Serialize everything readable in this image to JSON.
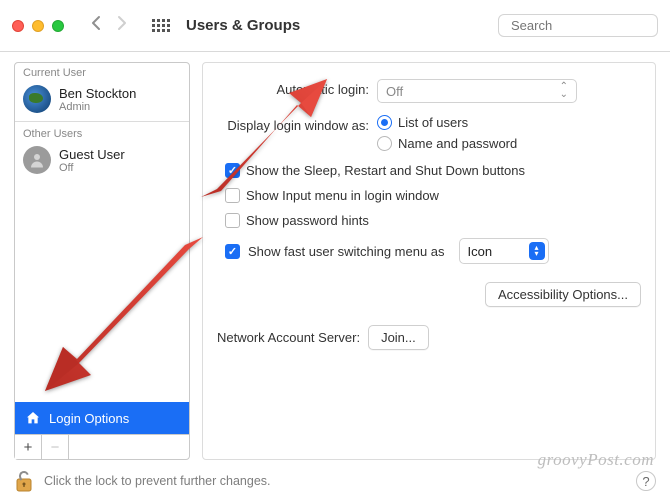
{
  "header": {
    "title": "Users & Groups",
    "search_placeholder": "Search"
  },
  "sidebar": {
    "section_current": "Current User",
    "section_other": "Other Users",
    "current": {
      "name": "Ben Stockton",
      "role": "Admin"
    },
    "other": {
      "name": "Guest User",
      "role": "Off"
    },
    "login_options": "Login Options",
    "add": "+",
    "remove": "−"
  },
  "settings": {
    "auto_login_label": "Automatic login:",
    "auto_login_value": "Off",
    "display_label": "Display login window as:",
    "radio_list": "List of users",
    "radio_namepw": "Name and password",
    "cb_sleep": "Show the Sleep, Restart and Shut Down buttons",
    "cb_input": "Show Input menu in login window",
    "cb_hints": "Show password hints",
    "cb_fast": "Show fast user switching menu as",
    "fast_value": "Icon",
    "accessibility": "Accessibility Options...",
    "nas_label": "Network Account Server:",
    "nas_join": "Join..."
  },
  "footer": {
    "lock_text": "Click the lock to prevent further changes.",
    "help": "?",
    "watermark": "groovyPost.com"
  }
}
